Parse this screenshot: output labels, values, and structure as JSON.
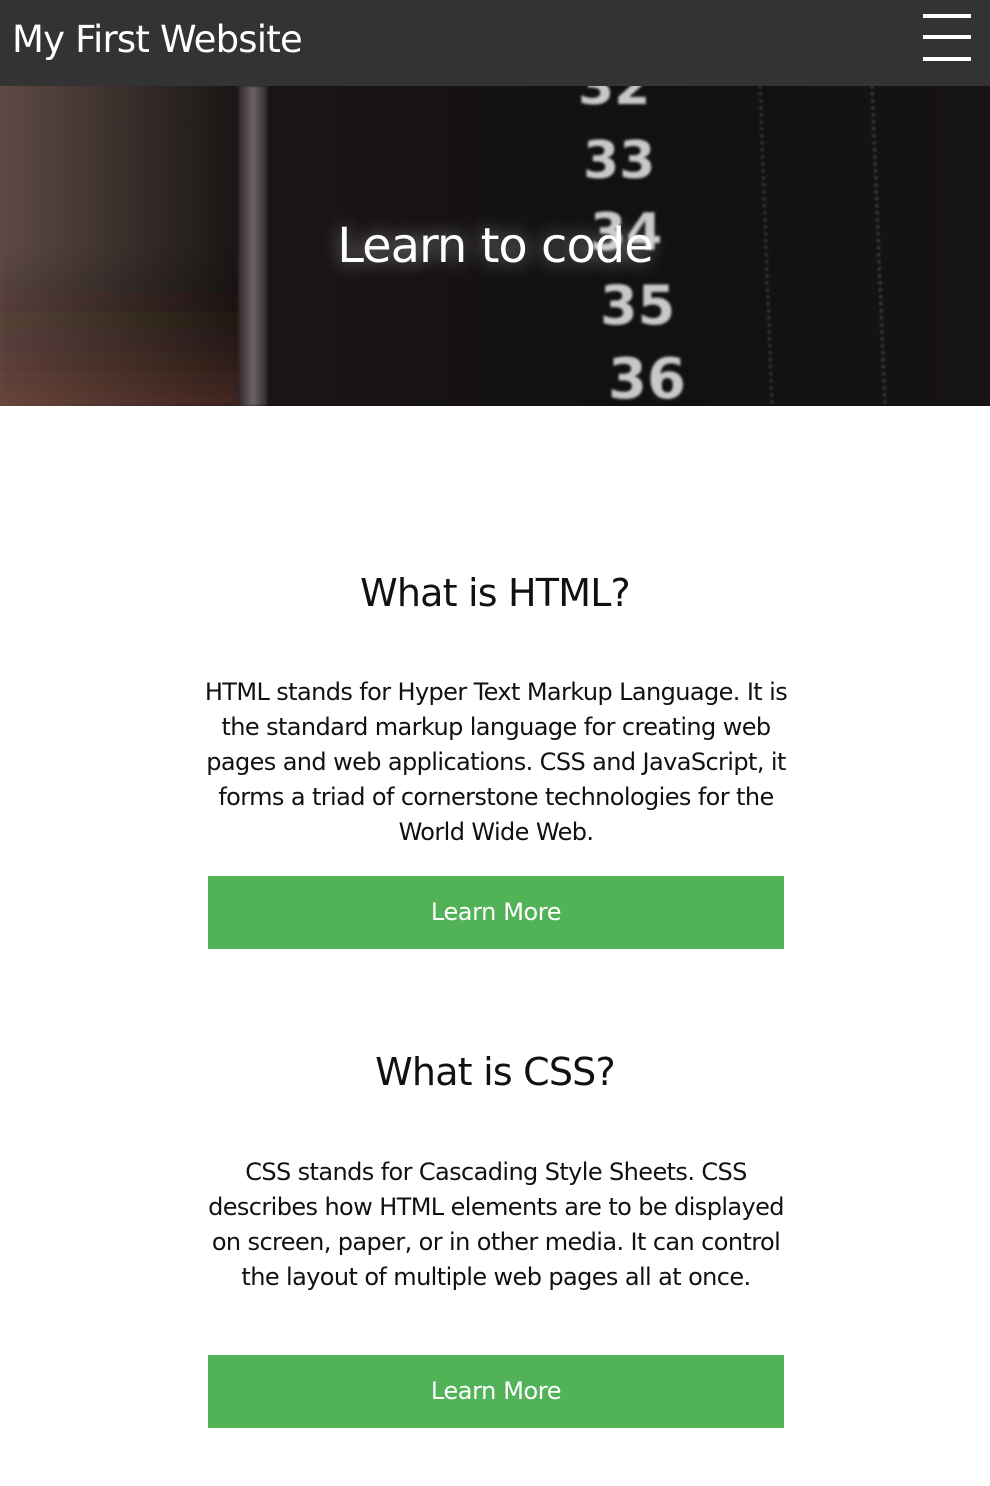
{
  "header": {
    "site_title": "My First Website",
    "menu_icon": "hamburger-menu-icon"
  },
  "hero": {
    "heading": "Learn to code",
    "background_numbers": [
      "32",
      "33",
      "34",
      "35",
      "36"
    ]
  },
  "sections": [
    {
      "title": "What is HTML?",
      "text": "HTML stands for Hyper Text Markup Language. It is the standard markup language for creating web pages and web applications. CSS and JavaScript, it forms a triad of cornerstone technologies for the World Wide Web.",
      "button_label": "Learn More"
    },
    {
      "title": "What is CSS?",
      "text": "CSS stands for Cascading Style Sheets. CSS describes how HTML elements are to be displayed on screen, paper, or in other media. It can control the layout of multiple web pages all at once.",
      "button_label": "Learn More"
    }
  ],
  "colors": {
    "header_bg": "#333333",
    "button_bg": "#52b257",
    "button_text": "#ffffff",
    "page_bg": "#ffffff"
  }
}
